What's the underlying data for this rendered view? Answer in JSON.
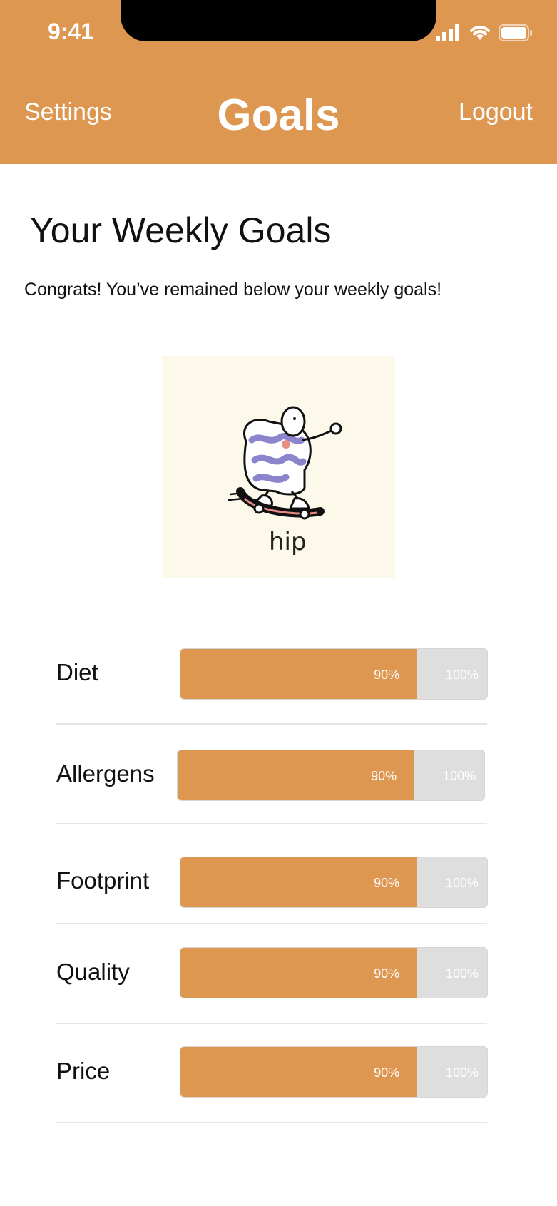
{
  "status_bar": {
    "time": "9:41"
  },
  "nav": {
    "left": "Settings",
    "title": "Goals",
    "right": "Logout"
  },
  "section": {
    "title": "Your Weekly Goals",
    "message": "Congrats! You’ve remained below your weekly goals!"
  },
  "illustration": {
    "caption": "hip"
  },
  "colors": {
    "accent": "#DE9750",
    "track": "#DEDEDE",
    "illustration_bg": "#FCF9EA"
  },
  "goals": [
    {
      "label": "Diet",
      "value_label": "90%",
      "max_label": "100%",
      "progress": 0.77
    },
    {
      "label": "Allergens",
      "value_label": "90%",
      "max_label": "100%",
      "progress": 0.77
    },
    {
      "label": "Footprint",
      "value_label": "90%",
      "max_label": "100%",
      "progress": 0.77
    },
    {
      "label": "Quality",
      "value_label": "90%",
      "max_label": "100%",
      "progress": 0.77
    },
    {
      "label": "Price",
      "value_label": "90%",
      "max_label": "100%",
      "progress": 0.77
    }
  ]
}
